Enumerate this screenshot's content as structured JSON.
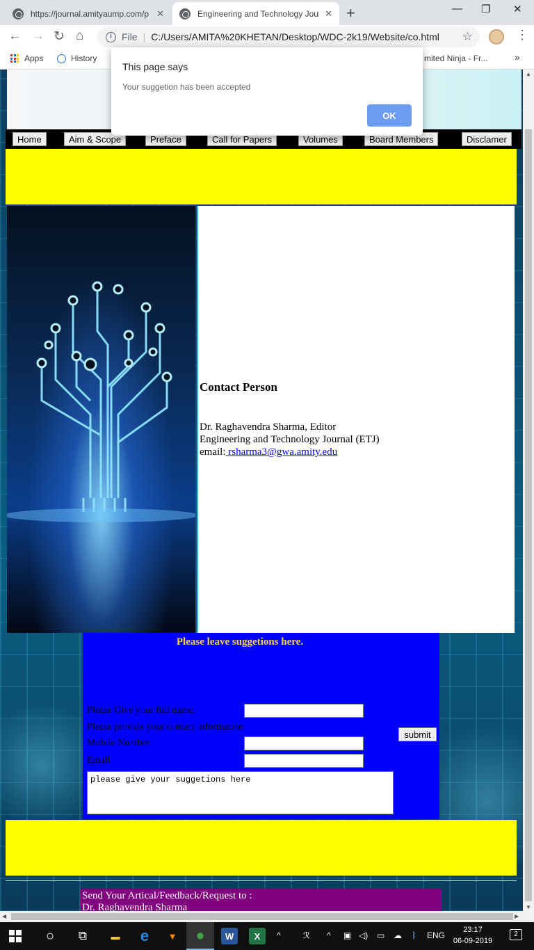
{
  "browser": {
    "tabs": [
      {
        "title": "https://journal.amityaump.com/p",
        "close": "✕"
      },
      {
        "title": "Engineering and Technology Jour",
        "close": "✕"
      }
    ],
    "new_tab": "+",
    "window_controls": {
      "minimize": "—",
      "restore": "❐",
      "close": "✕"
    },
    "nav": {
      "back": "←",
      "forward": "→",
      "reload": "↻",
      "home": "⌂"
    },
    "address": {
      "scheme_label": "File",
      "url": "C:/Users/AMITA%20KHETAN/Desktop/WDC-2k19/Website/co.html",
      "info_icon": "i",
      "star": "☆"
    },
    "menu": "⋮",
    "bookmarks": [
      {
        "label": "Apps"
      },
      {
        "label": "History"
      },
      {
        "label": "mited Ninja - Fr..."
      }
    ],
    "bookmarks_more": "»"
  },
  "dialog": {
    "title": "This page says",
    "message": "Your suggetion has been accepted",
    "ok_label": "OK"
  },
  "site_nav": {
    "items": [
      "Home",
      "Aim & Scope",
      "Preface",
      "Call for Papers",
      "Volumes",
      "Board Members",
      "Disclamer"
    ]
  },
  "contact": {
    "heading": "Contact Person",
    "name_line": "Dr. Raghavendra Sharma, Editor",
    "journal_line": "Engineering and Technology Journal (ETJ)",
    "email_label": "email:",
    "email": " rsharma3@gwa.amity.edu"
  },
  "suggestion_form": {
    "title": "Please leave suggetions here.",
    "full_name_label": "Please Give your full name:",
    "contact_info_label": "Please provide your contact information",
    "mobile_label": "Mobile Number",
    "email_label": "Email",
    "submit_label": "submit",
    "textarea_value": "please give your suggetions here"
  },
  "footer_box": {
    "line1": "Send Your Artical/Feedback/Request to :",
    "line2": "Dr. Raghavendra Sharma"
  },
  "scrollbars": {
    "up": "▲",
    "down": "▼",
    "left": "◀",
    "right": "▶"
  },
  "taskbar": {
    "search_icon": "○",
    "task_view_icon": "⧉",
    "apps": [
      {
        "name": "file-explorer",
        "glyph": "▬",
        "color": "#f4c542"
      },
      {
        "name": "edge",
        "glyph": "e",
        "color": "#1e88e5"
      },
      {
        "name": "brave",
        "glyph": "▼",
        "color": "#fb8c00"
      },
      {
        "name": "chrome",
        "glyph": "●",
        "color": "#43a047"
      },
      {
        "name": "word",
        "glyph": "W",
        "color": "#2b579a"
      },
      {
        "name": "excel",
        "glyph": "X",
        "color": "#217346"
      }
    ],
    "tray_chevron": "^",
    "language": "ENG",
    "time": "23:17",
    "date": "06-09-2019",
    "notifications": "2"
  }
}
